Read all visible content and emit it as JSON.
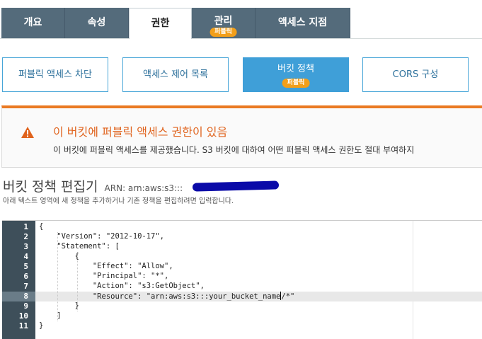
{
  "tabs": [
    {
      "label": "개요"
    },
    {
      "label": "속성"
    },
    {
      "label": "권한"
    },
    {
      "label": "관리",
      "badge": "퍼블릭"
    },
    {
      "label": "액세스 지점"
    }
  ],
  "subtabs": [
    {
      "label": "퍼블릭 액세스 차단"
    },
    {
      "label": "액세스 제어 목록"
    },
    {
      "label": "버킷 정책",
      "badge": "퍼블릭"
    },
    {
      "label": "CORS 구성"
    }
  ],
  "warning": {
    "icon": "warning-triangle-icon",
    "color": "#e0631d",
    "title": "이 버킷에 퍼블릭 액세스 권한이 있음",
    "body": "이 버킷에 퍼블릭 액세스를 제공했습니다. S3 버킷에 대하여 어떤 퍼블릭 액세스 권한도 절대 부여하지"
  },
  "editor": {
    "title": "버킷 정책 편집기",
    "arn": "ARN: arn:aws:s3:::",
    "description": "아래 텍스트 영역에 새 정책을 추가하거나 기존 정책을 편집하려면 입력합니다.",
    "active_line": 8,
    "lines": [
      "{",
      "    \"Version\": \"2012-10-17\",",
      "    \"Statement\": [",
      "        {",
      "            \"Effect\": \"Allow\",",
      "            \"Principal\": \"*\",",
      "            \"Action\": \"s3:GetObject\",",
      "            \"Resource\": \"arn:aws:s3:::your_bucket_name/*\"",
      "        }",
      "    ]",
      "}"
    ]
  }
}
